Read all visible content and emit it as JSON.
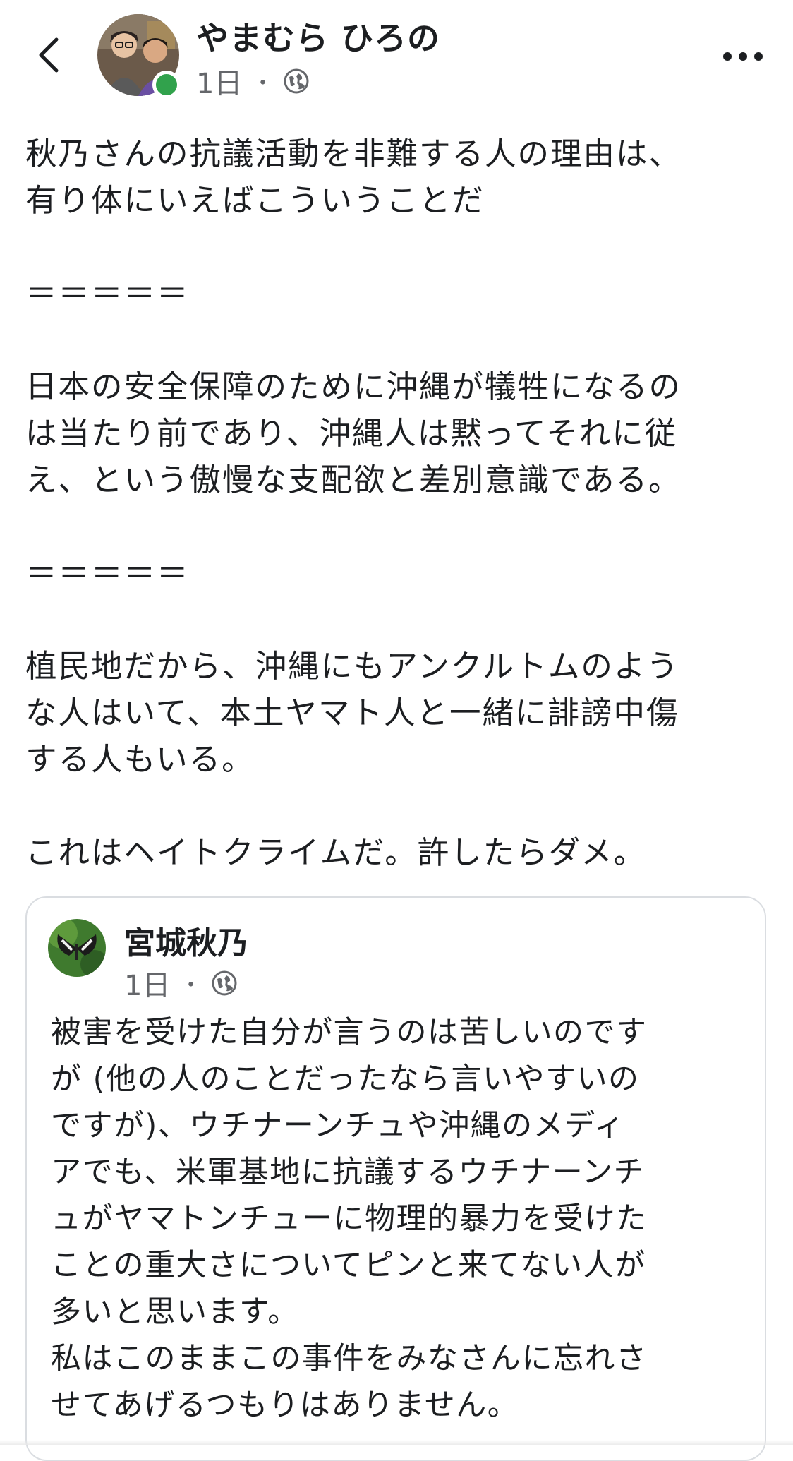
{
  "header": {
    "author_name": "やまむら ひろの",
    "timestamp": "1日",
    "separator": "・",
    "audience_icon": "globe-icon",
    "back_icon": "chevron-left-icon",
    "more_icon": "more-horizontal-icon"
  },
  "post": {
    "lines": [
      "秋乃さんの抗議活動を非難する人の理由は、",
      "有り体にいえばこういうことだ",
      "",
      "＝＝＝＝＝",
      "",
      "日本の安全保障のために沖縄が犠牲になるの",
      "は当たり前であり、沖縄人は黙ってそれに従",
      "え、という傲慢な支配欲と差別意識である。",
      "",
      "＝＝＝＝＝",
      "",
      "植民地だから、沖縄にもアンクルトムのよう",
      "な人はいて、本土ヤマト人と一緒に誹謗中傷",
      "する人もいる。",
      "",
      "これはヘイトクライムだ。許したらダメ。"
    ]
  },
  "shared_post": {
    "author_name": "宮城秋乃",
    "timestamp": "1日",
    "separator": "・",
    "audience_icon": "globe-icon",
    "lines": [
      "被害を受けた自分が言うのは苦しいのです",
      "が (他の人のことだったなら言いやすいの",
      "ですが)、ウチナーンチュや沖縄のメディ",
      "アでも、米軍基地に抗議するウチナーンチ",
      "ュがヤマトンチューに物理的暴力を受けた",
      "ことの重大さについてピンと来てない人が",
      "多いと思います。",
      "私はこのままこの事件をみなさんに忘れさ",
      "せてあげるつもりはありません。"
    ]
  },
  "colors": {
    "text": "#1c1e21",
    "secondary_text": "#65676b",
    "online": "#31a24c",
    "card_border": "#dadde1"
  }
}
